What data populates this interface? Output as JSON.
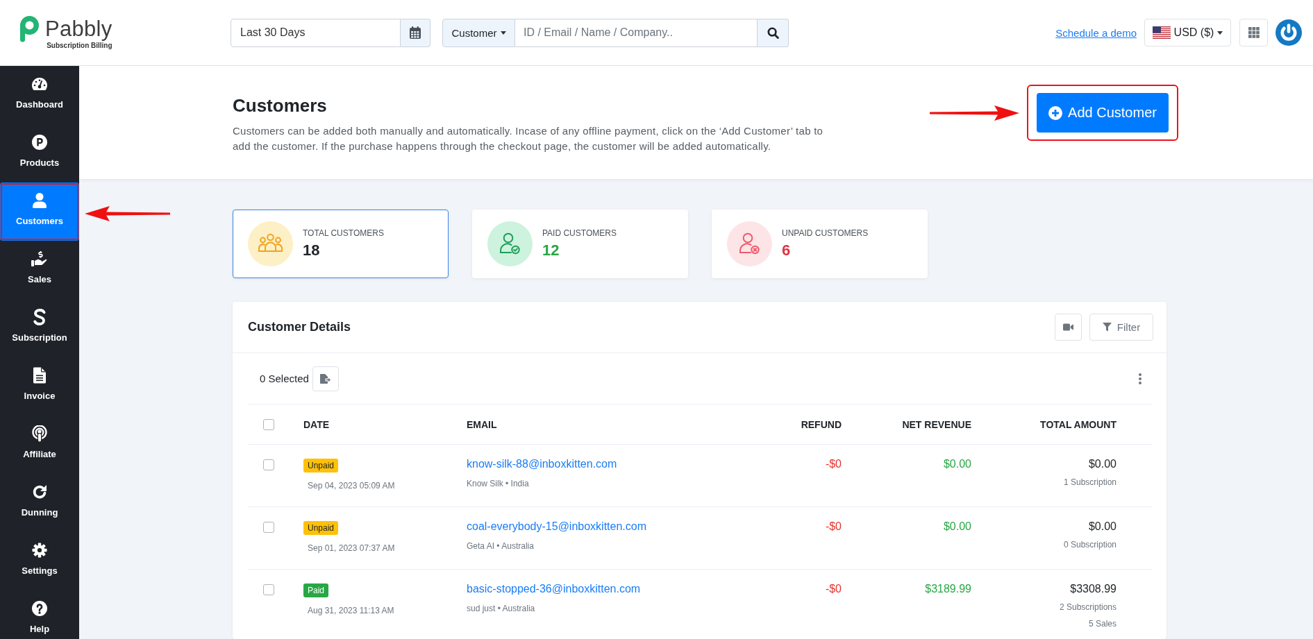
{
  "header": {
    "logo": {
      "name": "Pabbly",
      "tagline": "Subscription Billing"
    },
    "date_range": {
      "value": "Last 30 Days"
    },
    "search": {
      "scope": "Customer",
      "placeholder": "ID / Email / Name / Company.."
    },
    "demo_link": "Schedule a demo",
    "currency": "USD ($)"
  },
  "sidebar": {
    "items": [
      {
        "label": "Dashboard",
        "selected": false,
        "highlighted": false
      },
      {
        "label": "Products",
        "selected": false,
        "highlighted": false
      },
      {
        "label": "Customers",
        "selected": true,
        "highlighted": true
      },
      {
        "label": "Sales",
        "selected": false,
        "highlighted": false
      },
      {
        "label": "Subscription",
        "selected": false,
        "highlighted": false
      },
      {
        "label": "Invoice",
        "selected": false,
        "highlighted": false
      },
      {
        "label": "Affiliate",
        "selected": false,
        "highlighted": false
      },
      {
        "label": "Dunning",
        "selected": false,
        "highlighted": false
      },
      {
        "label": "Settings",
        "selected": false,
        "highlighted": false
      },
      {
        "label": "Help",
        "selected": false,
        "highlighted": false
      }
    ]
  },
  "page": {
    "title": "Customers",
    "description": "Customers can be added both manually and automatically. Incase of any offline payment, click on the ‘Add Customer’ tab to add the customer. If the purchase happens through the checkout page, the customer will be added automatically.",
    "add_button": {
      "label": "Add Customer",
      "highlighted": true
    }
  },
  "stats": [
    {
      "kind": "total",
      "label": "TOTAL CUSTOMERS",
      "value": "18",
      "selected": true
    },
    {
      "kind": "paid",
      "label": "PAID CUSTOMERS",
      "value": "12",
      "selected": false
    },
    {
      "kind": "unpaid",
      "label": "UNPAID CUSTOMERS",
      "value": "6",
      "selected": false
    }
  ],
  "customer_details": {
    "title": "Customer Details",
    "filter_label": "Filter",
    "selected_count": "0 Selected",
    "select_all": {
      "checked": false
    },
    "columns": [
      "DATE",
      "EMAIL",
      "REFUND",
      "NET REVENUE",
      "TOTAL AMOUNT"
    ],
    "rows": [
      {
        "checked": false,
        "status": {
          "label": "Unpaid",
          "color": "#ffc107"
        },
        "date": "Sep 04, 2023 05:09 AM",
        "email": "know-silk-88@inboxkitten.com",
        "customer": "Know Silk • India",
        "refund": "-$0",
        "net_revenue": "$0.00",
        "total_amount": "$0.00",
        "summary": [
          "1 Subscription"
        ]
      },
      {
        "checked": false,
        "status": {
          "label": "Unpaid",
          "color": "#ffc107"
        },
        "date": "Sep 01, 2023 07:37 AM",
        "email": "coal-everybody-15@inboxkitten.com",
        "customer": "Geta AI • Australia",
        "refund": "-$0",
        "net_revenue": "$0.00",
        "total_amount": "$0.00",
        "summary": [
          "0 Subscription"
        ]
      },
      {
        "checked": false,
        "status": {
          "label": "Paid",
          "color": "#28a745"
        },
        "date": "Aug 31, 2023 11:13 AM",
        "email": "basic-stopped-36@inboxkitten.com",
        "customer": "sud just • Australia",
        "refund": "-$0",
        "net_revenue": "$3189.99",
        "total_amount": "$3308.99",
        "summary": [
          "2 Subscriptions",
          "5 Sales"
        ]
      }
    ]
  }
}
